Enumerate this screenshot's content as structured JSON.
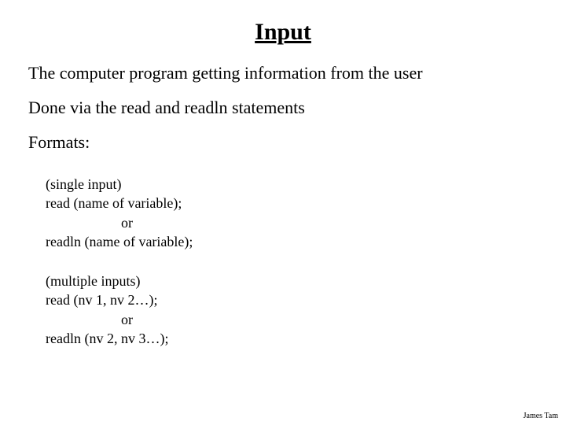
{
  "title": "Input",
  "line1": "The computer program getting information from the user",
  "line2": "Done via the read and readln statements",
  "formats_label": "Formats:",
  "block1": {
    "header": " (single input)",
    "l1": "read (name of variable);",
    "or": "or",
    "l2": "readln (name of variable);"
  },
  "block2": {
    "header": "(multiple inputs)",
    "l1": "read (nv 1, nv 2…);",
    "or": "or",
    "l2": "readln (nv 2, nv 3…);"
  },
  "footer": "James Tam"
}
